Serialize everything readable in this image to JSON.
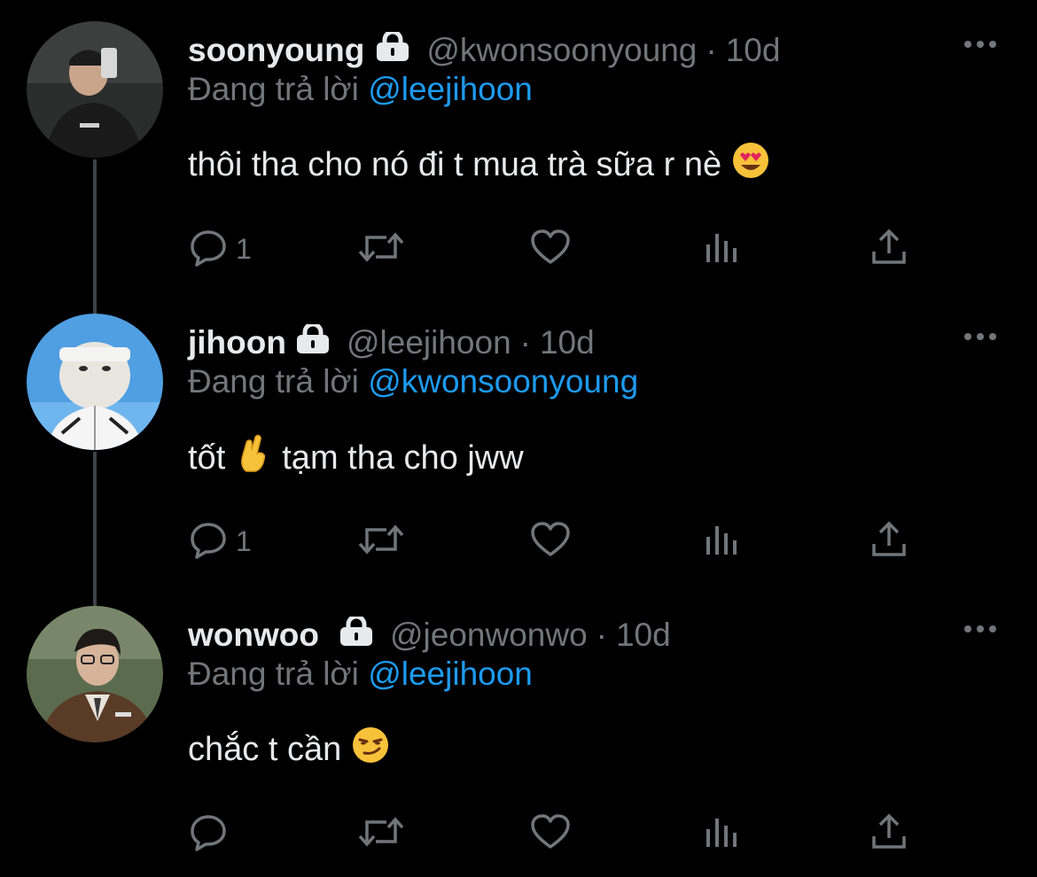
{
  "thread": [
    {
      "name": "soonyoung",
      "handle": "@kwonsoonyoung",
      "separator": "·",
      "time": "10d",
      "replying_prefix": "Đang trả lời",
      "replying_to": "@leejihoon",
      "text": "thôi tha cho nó đi t mua trà sữa r nè",
      "emoji": "smiling-face-with-heart-eyes",
      "reply_count": "1",
      "avatar_color": "#8a8f8c"
    },
    {
      "name": "jihoon",
      "handle": "@leejihoon",
      "separator": "·",
      "time": "10d",
      "replying_prefix": "Đang trả lời",
      "replying_to": "@kwonsoonyoung",
      "text": "tạm tha cho jww",
      "text_prefix": "tốt",
      "emoji": "crossed-fingers",
      "reply_count": "1",
      "avatar_color": "#5aa8e8"
    },
    {
      "name": "wonwoo",
      "handle": "@jeonwonwo",
      "separator": "·",
      "time": "10d",
      "replying_prefix": "Đang trả lời",
      "replying_to": "@leejihoon",
      "text": "chắc t cần",
      "emoji": "smirking-face",
      "reply_count": "",
      "avatar_color": "#6b5a45"
    }
  ],
  "icons": {
    "lock": "lock-icon",
    "more": "more-icon",
    "reply": "reply-icon",
    "retweet": "retweet-icon",
    "like": "like-icon",
    "views": "views-icon",
    "share": "share-icon"
  },
  "colors": {
    "background": "#000000",
    "text": "#e7e9ea",
    "muted": "#71767b",
    "link": "#1d9bf0",
    "thread_line": "#3d4247"
  }
}
